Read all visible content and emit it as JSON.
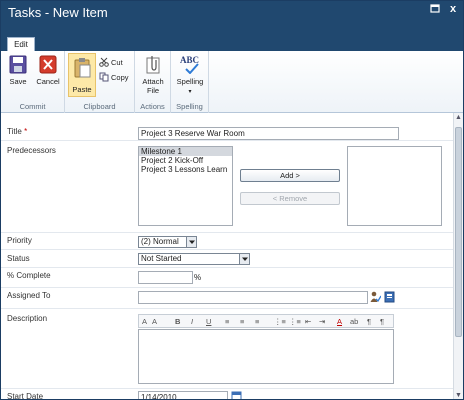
{
  "window": {
    "title": "Tasks - New Item",
    "close_glyph": "x"
  },
  "ribbon": {
    "tabs": [
      {
        "label": "Edit"
      }
    ],
    "groups": {
      "commit": {
        "label": "Commit",
        "save": "Save",
        "cancel": "Cancel"
      },
      "clipboard": {
        "label": "Clipboard",
        "paste": "Paste",
        "cut": "Cut",
        "copy": "Copy"
      },
      "actions": {
        "label": "Actions",
        "attach_file_line1": "Attach",
        "attach_file_line2": "File"
      },
      "spelling": {
        "label": "Spelling",
        "spelling": "Spelling",
        "icon_text": "ABC"
      }
    }
  },
  "form": {
    "title": {
      "label": "Title",
      "required_marker": "*",
      "value": "Project 3 Reserve War Room"
    },
    "predecessors": {
      "label": "Predecessors",
      "available": [
        "Milestone 1",
        "Project 2 Kick-Off",
        "Project 3 Lessons Learn"
      ],
      "selected_index": 0,
      "add_label": "Add >",
      "remove_label": "< Remove"
    },
    "priority": {
      "label": "Priority",
      "value": "(2) Normal"
    },
    "status": {
      "label": "Status",
      "value": "Not Started"
    },
    "percent_complete": {
      "label": "% Complete",
      "value": "",
      "unit": "%"
    },
    "assigned_to": {
      "label": "Assigned To",
      "value": ""
    },
    "description": {
      "label": "Description",
      "value": ""
    },
    "start_date": {
      "label": "Start Date",
      "value": "1/14/2010"
    }
  },
  "rte_toolbar": [
    "A",
    "A",
    "B",
    "I",
    "U",
    "≡",
    "≡",
    "≡",
    "⋮≡",
    "⋮≡",
    "⇤",
    "⇥",
    "A",
    "ab",
    "¶",
    "¶"
  ],
  "colors": {
    "titlebar": "#20486f",
    "required": "#c00000",
    "paste_highlight": "#fde9a8"
  }
}
